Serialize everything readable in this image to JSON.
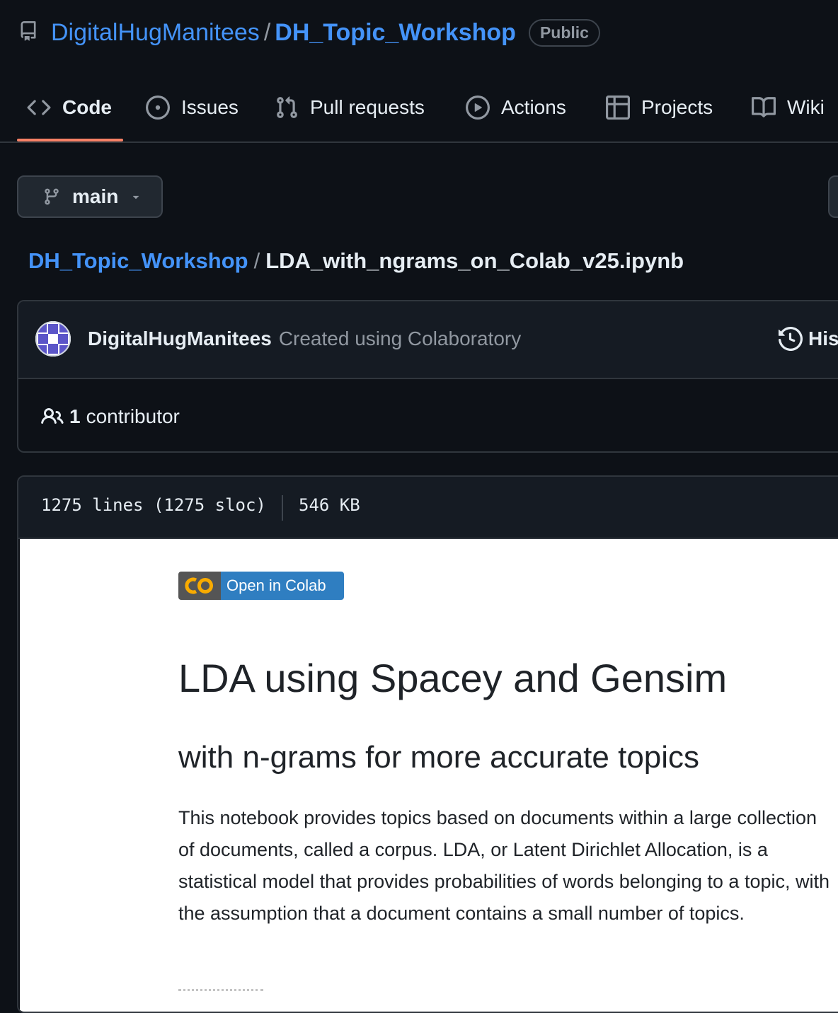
{
  "repo": {
    "owner": "DigitalHugManitees",
    "separator": "/",
    "name": "DH_Topic_Workshop",
    "visibility": "Public"
  },
  "tabs": [
    {
      "label": "Code",
      "icon": "code-icon",
      "active": true
    },
    {
      "label": "Issues",
      "icon": "issue-opened-icon"
    },
    {
      "label": "Pull requests",
      "icon": "git-pull-request-icon"
    },
    {
      "label": "Actions",
      "icon": "play-icon"
    },
    {
      "label": "Projects",
      "icon": "table-icon"
    },
    {
      "label": "Wiki",
      "icon": "book-icon"
    }
  ],
  "branch": {
    "label": "main",
    "icon": "git-branch-icon"
  },
  "breadcrumb": {
    "repo": "DH_Topic_Workshop",
    "separator": "/",
    "file": "LDA_with_ngrams_on_Colab_v25.ipynb"
  },
  "commit": {
    "author": "DigitalHugManitees",
    "message": "Created using Colaboratory",
    "history_label": "His"
  },
  "contributors": {
    "count": "1",
    "label": "contributor"
  },
  "file_info": {
    "lines": "1275 lines (1275 sloc)",
    "size": "546 KB"
  },
  "notebook": {
    "badge_logo": "CO",
    "badge_label": "Open in Colab",
    "title": "LDA using Spacey and Gensim",
    "subtitle": "with n-grams for more accurate topics",
    "paragraph": "This notebook provides topics based on documents within a large collection of documents, called a corpus. LDA, or Latent Dirichlet Allocation, is a statistical model that provides probabilities of words belonging to a topic, with the assumption that a document contains a small number of topics."
  },
  "colors": {
    "link": "#4493f8",
    "background": "#0d1117",
    "tab_underline": "#f78166",
    "colab_blue": "#2f7ec1",
    "colab_orange": "#f9ab00"
  }
}
